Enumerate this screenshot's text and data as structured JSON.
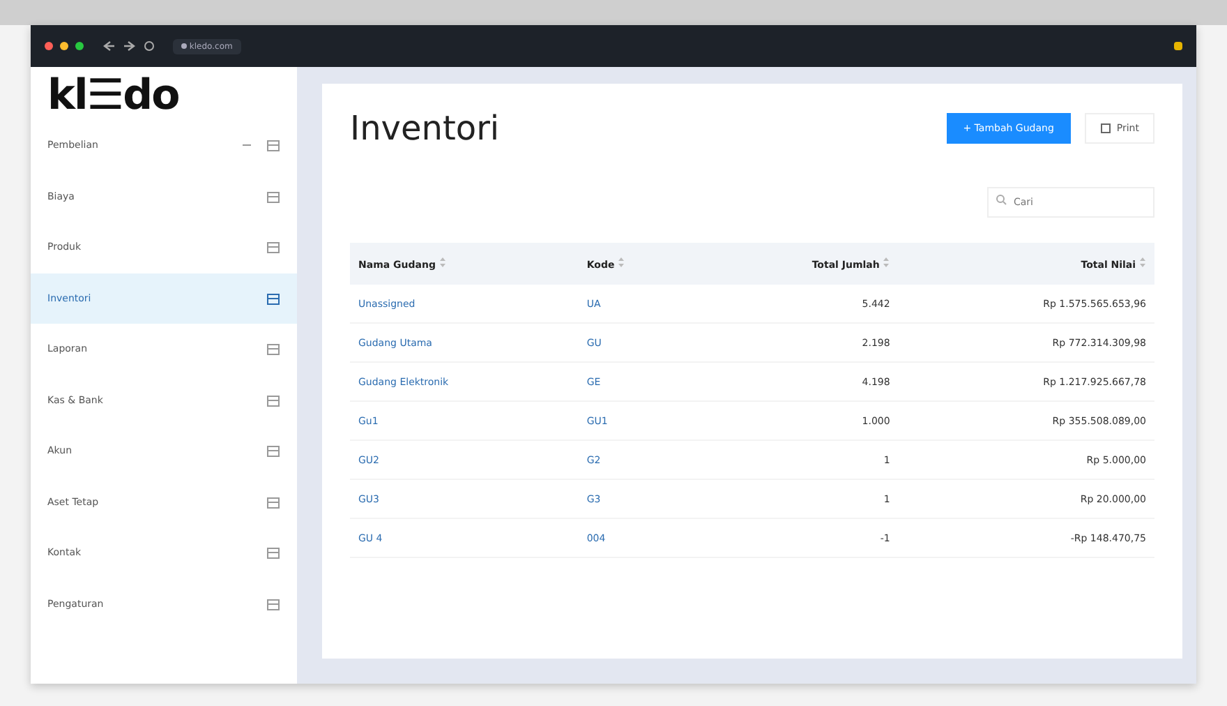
{
  "browser": {
    "url": "kledo.com"
  },
  "sidebar": {
    "logo": "kl☰do",
    "items": [
      {
        "label": "Pembelian",
        "selected": false,
        "expanded": false
      },
      {
        "label": "Biaya",
        "selected": false
      },
      {
        "label": "Produk",
        "selected": false
      },
      {
        "label": "Inventori",
        "selected": true
      },
      {
        "label": "Laporan",
        "selected": false
      },
      {
        "label": "Kas & Bank",
        "selected": false
      },
      {
        "label": "Akun",
        "selected": false
      },
      {
        "label": "Aset Tetap",
        "selected": false
      },
      {
        "label": "Kontak",
        "selected": false
      },
      {
        "label": "Pengaturan",
        "selected": false
      }
    ]
  },
  "page": {
    "title": "Inventori",
    "add_button": "+ Tambah Gudang",
    "print_button": "Print",
    "search": {
      "placeholder": "Cari"
    }
  },
  "table": {
    "columns": [
      {
        "label": "Nama Gudang"
      },
      {
        "label": "Kode"
      },
      {
        "label": "Total Jumlah"
      },
      {
        "label": "Total Nilai"
      }
    ],
    "rows": [
      [
        "Unassigned",
        "UA",
        "5.442",
        "Rp 1.575.565.653,96"
      ],
      [
        "Gudang Utama",
        "GU",
        "2.198",
        "Rp 772.314.309,98"
      ],
      [
        "Gudang Elektronik",
        "GE",
        "4.198",
        "Rp 1.217.925.667,78"
      ],
      [
        "Gu1",
        "GU1",
        "1.000",
        "Rp 355.508.089,00"
      ],
      [
        "GU2",
        "G2",
        "1",
        "Rp 5.000,00"
      ],
      [
        "GU3",
        "G3",
        "1",
        "Rp 20.000,00"
      ],
      [
        "GU 4",
        "004",
        "-1",
        "-Rp 148.470,75"
      ]
    ]
  }
}
